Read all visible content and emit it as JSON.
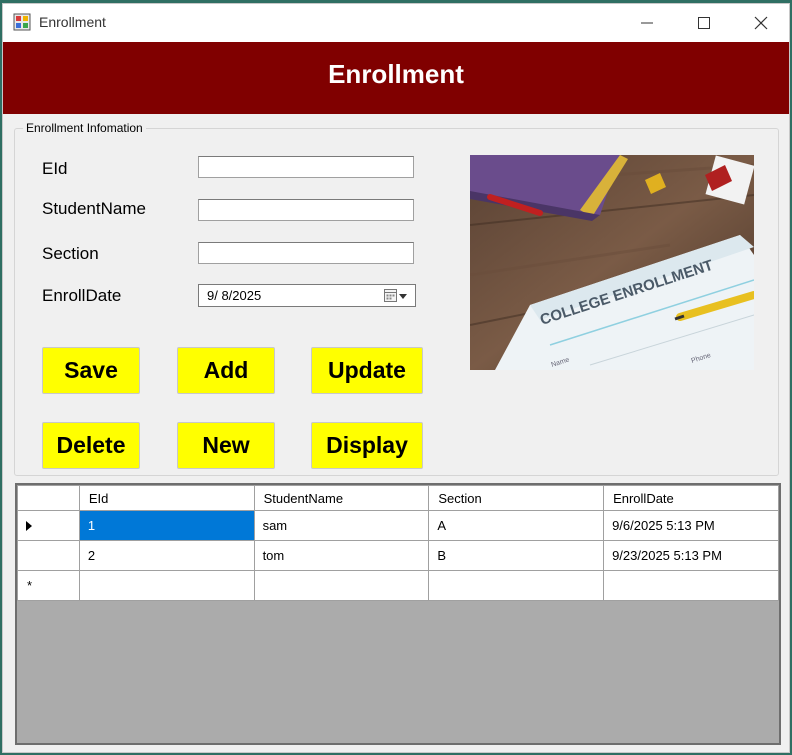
{
  "window": {
    "title": "Enrollment",
    "icons": {
      "app": "forms-app-icon",
      "minimize": "minimize-icon",
      "maximize": "maximize-icon",
      "close": "close-icon"
    }
  },
  "header": {
    "title": "Enrollment",
    "bg_color": "#800000"
  },
  "form": {
    "group_title": "Enrollment Infomation",
    "fields": {
      "eid": {
        "label": "EId",
        "value": ""
      },
      "student_name": {
        "label": "StudentName",
        "value": ""
      },
      "section": {
        "label": "Section",
        "value": ""
      },
      "enroll_date": {
        "label": "EnrollDate",
        "value": "9/  8/2025"
      }
    },
    "buttons": {
      "save": "Save",
      "add": "Add",
      "update": "Update",
      "delete": "Delete",
      "new": "New",
      "display": "Display"
    },
    "button_color": "#ffff00"
  },
  "photo": {
    "caption_text": "COLLEGE ENROLLMENT",
    "form_field_1": "Name",
    "form_field_2": "Phone"
  },
  "grid": {
    "columns": [
      "EId",
      "StudentName",
      "Section",
      "EnrollDate"
    ],
    "rows": [
      {
        "eid": "1",
        "student_name": "sam",
        "section": "A",
        "enroll_date": "9/6/2025 5:13 PM"
      },
      {
        "eid": "2",
        "student_name": "tom",
        "section": "B",
        "enroll_date": "9/23/2025 5:13 PM"
      }
    ],
    "selection_color": "#0078d7"
  }
}
